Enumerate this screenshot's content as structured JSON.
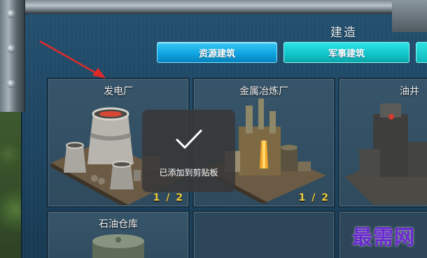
{
  "panel": {
    "title": "建造",
    "tabs": [
      {
        "label": "资源建筑",
        "active": true
      },
      {
        "label": "军事建筑",
        "active": false
      },
      {
        "label": "",
        "active": false
      }
    ]
  },
  "buildings": [
    {
      "name": "发电厂",
      "count": "1 / 2",
      "icon": "power-plant-icon"
    },
    {
      "name": "金属冶炼厂",
      "count": "1 / 2",
      "icon": "metal-smelter-icon"
    },
    {
      "name": "油井",
      "count": "",
      "icon": "oil-well-icon"
    },
    {
      "name": "石油仓库",
      "count": "",
      "icon": "oil-depot-icon"
    }
  ],
  "toast": {
    "message": "已添加到剪贴板",
    "icon": "checkmark-icon"
  },
  "watermark": "最需网",
  "colors": {
    "active_tab": "#10a5e1",
    "inactive_tab": "#12c8cc",
    "panel": "#1e4663",
    "count_text": "#f2cf3b",
    "arrow": "#e02a2a",
    "watermark": "#6b2ad1"
  }
}
